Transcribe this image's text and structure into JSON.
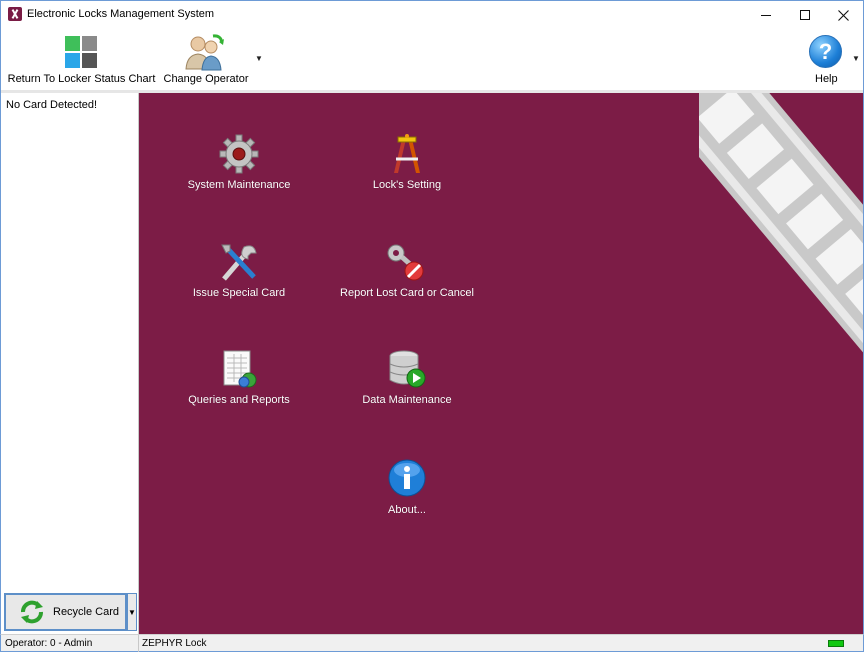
{
  "window": {
    "title": "Electronic Locks Management System",
    "accent": "#6d9bd6"
  },
  "toolbar": {
    "return_label": "Return To Locker Status Chart",
    "operator_label": "Change Operator",
    "help_label": "Help",
    "dropdown_glyph": "▼"
  },
  "left_panel": {
    "card_status": "No Card Detected!",
    "recycle_label": "Recycle Card",
    "recycle_icon": "recycle-arrows-icon"
  },
  "main": {
    "background": "#7c1c46",
    "items": [
      {
        "label": "System Maintenance",
        "icon": "gear-icon"
      },
      {
        "label": "Lock's Setting",
        "icon": "lock-barrier-icon"
      },
      {
        "label": "Issue Special Card",
        "icon": "tools-icon"
      },
      {
        "label": "Report Lost Card or Cancel",
        "icon": "key-cancel-icon"
      },
      {
        "label": "Queries and Reports",
        "icon": "report-icon"
      },
      {
        "label": "Data Maintenance",
        "icon": "database-icon"
      },
      {
        "label": "About...",
        "icon": "info-icon"
      }
    ]
  },
  "statusbar": {
    "operator": "Operator: 0 - Admin",
    "lock": "ZEPHYR Lock",
    "led_color": "#11c811"
  }
}
